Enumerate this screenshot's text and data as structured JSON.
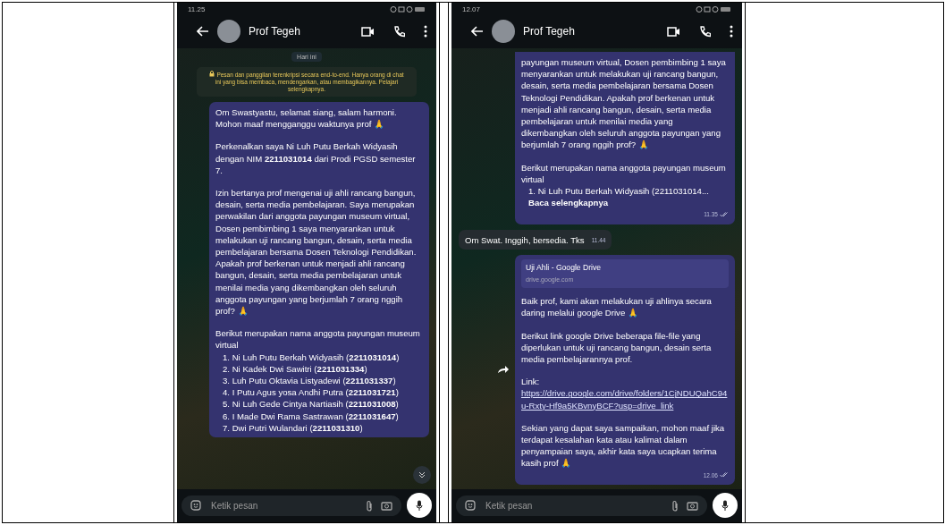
{
  "phones": [
    {
      "status_time": "11.25",
      "contact_name": "Prof Tegeh",
      "date_chip": "Hari ini",
      "notice": "Pesan dan panggilan terenkripsi secara end-to-end. Hanya orang di chat ini yang bisa membaca, mendengarkan, atau membagikannya. Pelajari selengkapnya.",
      "scroll_down_button": true,
      "messages": [
        {
          "kind": "outgoing",
          "cut_top": false,
          "paragraphs": [
            {
              "kind": "text",
              "text": "Om Swastyastu, selamat siang, salam harmoni. Mohon maaf mengganggu waktunya prof 🙏"
            },
            {
              "kind": "text",
              "text": "Perkenalkan saya Ni Luh Putu Berkah Widyasih dengan NIM **2211031014** dari Prodi PGSD semester 7."
            },
            {
              "kind": "text",
              "text": "Izin bertanya prof mengenai uji ahli rancang bangun, desain, serta media pembelajaran. Saya merupakan perwakilan dari anggota payungan museum virtual, Dosen pembimbing 1 saya menyarankan untuk melakukan uji rancang bangun, desain, serta media pembelajaran bersama Dosen Teknologi Pendidikan. Apakah prof berkenan untuk menjadi ahli rancang bangun, desain, serta media pembelajaran untuk menilai media yang dikembangkan oleh seluruh anggota payungan yang berjumlah 7 orang nggih prof? 🙏"
            },
            {
              "kind": "list",
              "text": "Berikut merupakan nama anggota payungan museum virtual",
              "items": [
                "1. Ni Luh Putu Berkah Widyasih (**2211031014**)",
                "2. Ni Kadek Dwi Sawitri (**2211031334**)",
                "3. Luh Putu Oktavia Listyadewi (**2211031337**)",
                "4. I Putu Agus yosa Andhi Putra (**2211031721**)",
                "5. Ni Luh Gede Cintya Nartiasih (**2211031008**)",
                "6. I Made Dwi Rama Sastrawan (**2211031647**)",
                "7. Dwi Putri Wulandari (**2211031310**)"
              ]
            }
          ]
        }
      ],
      "input_placeholder": "Ketik pesan"
    },
    {
      "status_time": "12.07",
      "contact_name": "Prof Tegeh",
      "messages": [
        {
          "kind": "outgoing",
          "cut_top": true,
          "time": "11.35",
          "paragraphs": [
            {
              "kind": "text",
              "text": "payungan museum virtual, Dosen pembimbing 1 saya menyarankan untuk melakukan uji rancang bangun, desain, serta media pembelajaran bersama Dosen Teknologi Pendidikan. Apakah prof berkenan untuk menjadi ahli rancang bangun, desain, serta media pembelajaran untuk menilai media yang dikembangkan oleh seluruh anggota payungan yang berjumlah 7 orang nggih prof? 🙏"
            },
            {
              "kind": "list",
              "text": "Berikut merupakan nama anggota payungan museum virtual",
              "items": [
                "1. Ni Luh Putu Berkah Widyasih (2211031014... **Baca selengkapnya**"
              ]
            }
          ]
        },
        {
          "kind": "incoming",
          "cut_top": false,
          "time": "11.44",
          "paragraphs": [
            {
              "kind": "text",
              "text": "Om Swat. Inggih, bersedia. Tks"
            }
          ]
        },
        {
          "kind": "outgoing",
          "cut_top": false,
          "time": "12.06",
          "forward_button": true,
          "preview": {
            "title": "Uji Ahli - Google Drive",
            "domain": "drive.google.com"
          },
          "paragraphs": [
            {
              "kind": "text",
              "text": "Baik prof, kami akan melakukan uji ahlinya secara daring melalui google Drive 🙏"
            },
            {
              "kind": "text",
              "text": "Berikut link google Drive beberapa file-file yang diperlukan untuk uji rancang bangun, desain serta media pembelajarannya prof."
            },
            {
              "kind": "link",
              "label": "Link:",
              "url": "https://drive.google.com/drive/folders/1CjNDUQahC94u-Rxty-Hf9a5KBvnyBCF?usp=drive_link"
            },
            {
              "kind": "text",
              "text": "Sekian yang dapat saya sampaikan, mohon maaf jika terdapat kesalahan kata atau kalimat dalam penyampaian saya, akhir kata saya ucapkan terima kasih prof 🙏"
            }
          ]
        }
      ],
      "input_placeholder": "Ketik pesan"
    }
  ]
}
